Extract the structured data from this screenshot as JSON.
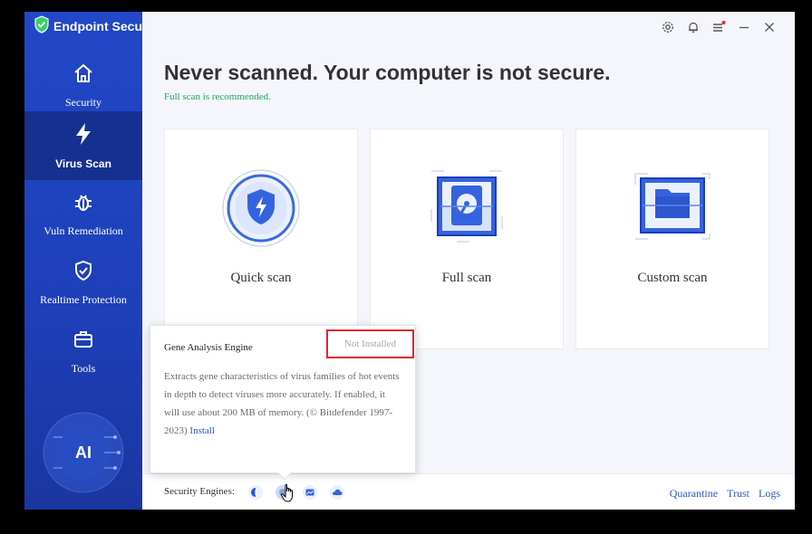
{
  "app": {
    "title": "Endpoint Secure"
  },
  "sidebar": {
    "items": [
      {
        "label": "Security",
        "icon": "home-icon"
      },
      {
        "label": "Virus Scan",
        "icon": "lightning-icon",
        "active": true
      },
      {
        "label": "Vuln Remediation",
        "icon": "bug-icon"
      },
      {
        "label": "Realtime Protection",
        "icon": "shield-check-icon"
      },
      {
        "label": "Tools",
        "icon": "toolbox-icon"
      }
    ],
    "ai_badge": "AI"
  },
  "topbar": {
    "icons": [
      "gear-icon",
      "bell-icon",
      "menu-icon",
      "minimize-icon",
      "close-icon"
    ]
  },
  "main": {
    "title": "Never scanned. Your computer is not secure.",
    "subtitle": "Full scan is recommended.",
    "cards": [
      {
        "label": "Quick scan",
        "icon": "quick-scan-icon"
      },
      {
        "label": "Full scan",
        "icon": "full-scan-icon"
      },
      {
        "label": "Custom scan",
        "icon": "custom-scan-icon"
      }
    ]
  },
  "bottom": {
    "engines_label": "Security Engines:",
    "links": {
      "quarantine": "Quarantine",
      "trust": "Trust",
      "logs": "Logs"
    }
  },
  "tooltip": {
    "title": "Gene Analysis Engine",
    "status": "Not Installed",
    "description": "Extracts gene characteristics of virus families of hot events in depth to detect viruses more accurately. If enabled, it will use about 200 MB of memory. (© Bitdefender 1997-2023) ",
    "install_label": "Install"
  },
  "colors": {
    "sidebar": "#2247c8",
    "accent": "#2c55c9",
    "success": "#23a55a",
    "alert": "#e0262e"
  }
}
